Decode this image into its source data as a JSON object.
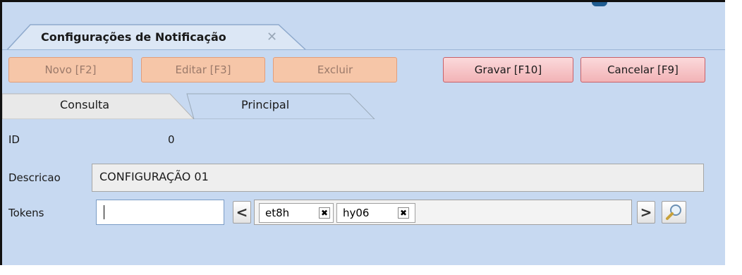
{
  "document_tab": {
    "title": "Configurações de Notificação",
    "close_glyph": "✕"
  },
  "toolbar": {
    "novo": "Novo [F2]",
    "editar": "Editar [F3]",
    "excluir": "Excluir",
    "gravar": "Gravar [F10]",
    "cancelar": "Cancelar [F9]"
  },
  "tabs": [
    {
      "label": "Consulta",
      "active": false
    },
    {
      "label": "Principal",
      "active": true
    }
  ],
  "form": {
    "id_label": "ID",
    "id_value": "0",
    "descricao_label": "Descricao",
    "descricao_value": "CONFIGURAÇÃO 01",
    "tokens_label": "Tokens",
    "token_input_value": "",
    "prev_glyph": "<",
    "next_glyph": ">",
    "tokens": [
      {
        "text": "et8h",
        "remove_glyph": "✖"
      },
      {
        "text": "hy06",
        "remove_glyph": "✖"
      }
    ]
  },
  "colors": {
    "background": "#c7d9f1",
    "disabled_button": "#f6c6a8",
    "active_button": "#f2b3b6"
  }
}
